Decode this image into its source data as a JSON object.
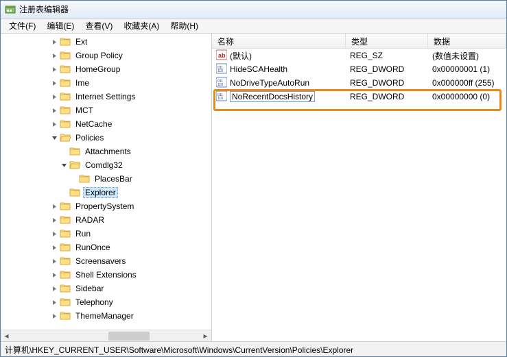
{
  "window": {
    "title": "注册表编辑器"
  },
  "menu": {
    "file": "文件(F)",
    "edit": "编辑(E)",
    "view": "查看(V)",
    "favorites": "收藏夹(A)",
    "help": "帮助(H)"
  },
  "tree": {
    "items": [
      {
        "indent": 5,
        "toggle": "closed",
        "label": "Ext"
      },
      {
        "indent": 5,
        "toggle": "closed",
        "label": "Group Policy"
      },
      {
        "indent": 5,
        "toggle": "closed",
        "label": "HomeGroup"
      },
      {
        "indent": 5,
        "toggle": "closed",
        "label": "Ime"
      },
      {
        "indent": 5,
        "toggle": "closed",
        "label": "Internet Settings"
      },
      {
        "indent": 5,
        "toggle": "closed",
        "label": "MCT"
      },
      {
        "indent": 5,
        "toggle": "closed",
        "label": "NetCache"
      },
      {
        "indent": 5,
        "toggle": "open",
        "label": "Policies"
      },
      {
        "indent": 6,
        "toggle": "none",
        "label": "Attachments"
      },
      {
        "indent": 6,
        "toggle": "open",
        "label": "Comdlg32"
      },
      {
        "indent": 7,
        "toggle": "none",
        "label": "PlacesBar"
      },
      {
        "indent": 6,
        "toggle": "none",
        "label": "Explorer",
        "selected": true
      },
      {
        "indent": 5,
        "toggle": "closed",
        "label": "PropertySystem"
      },
      {
        "indent": 5,
        "toggle": "closed",
        "label": "RADAR"
      },
      {
        "indent": 5,
        "toggle": "closed",
        "label": "Run"
      },
      {
        "indent": 5,
        "toggle": "closed",
        "label": "RunOnce"
      },
      {
        "indent": 5,
        "toggle": "closed",
        "label": "Screensavers"
      },
      {
        "indent": 5,
        "toggle": "closed",
        "label": "Shell Extensions"
      },
      {
        "indent": 5,
        "toggle": "closed",
        "label": "Sidebar"
      },
      {
        "indent": 5,
        "toggle": "closed",
        "label": "Telephony"
      },
      {
        "indent": 5,
        "toggle": "closed",
        "label": "ThemeManager"
      }
    ]
  },
  "list": {
    "columns": {
      "name": "名称",
      "type": "类型",
      "data": "数据"
    },
    "rows": [
      {
        "icon": "string",
        "name": "(默认)",
        "type": "REG_SZ",
        "data": "(数值未设置)"
      },
      {
        "icon": "binary",
        "name": "HideSCAHealth",
        "type": "REG_DWORD",
        "data": "0x00000001 (1)"
      },
      {
        "icon": "binary",
        "name": "NoDriveTypeAutoRun",
        "type": "REG_DWORD",
        "data": "0x000000ff (255)"
      },
      {
        "icon": "binary",
        "name": "NoRecentDocsHistory",
        "type": "REG_DWORD",
        "data": "0x00000000 (0)",
        "editing": true,
        "highlighted": true
      }
    ]
  },
  "statusbar": {
    "path": "计算机\\HKEY_CURRENT_USER\\Software\\Microsoft\\Windows\\CurrentVersion\\Policies\\Explorer"
  }
}
